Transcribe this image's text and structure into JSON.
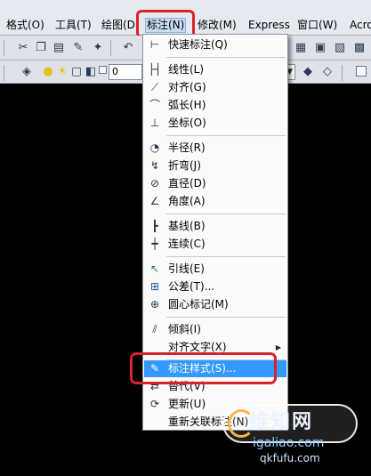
{
  "menubar": {
    "items": [
      "格式(O)",
      "工具(T)",
      "绘图(D)",
      "标注(N)",
      "修改(M)",
      "Express",
      "窗口(W)",
      "Acro"
    ]
  },
  "toolbar": {
    "layer_value": "0"
  },
  "dimension_menu": {
    "items": [
      {
        "label": "快速标注(Q)",
        "icon": "quick-dimension-icon"
      },
      {
        "label": "线性(L)",
        "icon": "linear-icon"
      },
      {
        "label": "对齐(G)",
        "icon": "aligned-icon"
      },
      {
        "label": "弧长(H)",
        "icon": "arc-length-icon"
      },
      {
        "label": "坐标(O)",
        "icon": "ordinate-icon"
      },
      {
        "label": "半径(R)",
        "icon": "radius-icon"
      },
      {
        "label": "折弯(J)",
        "icon": "jogged-icon"
      },
      {
        "label": "直径(D)",
        "icon": "diameter-icon"
      },
      {
        "label": "角度(A)",
        "icon": "angular-icon"
      },
      {
        "label": "基线(B)",
        "icon": "baseline-icon"
      },
      {
        "label": "连续(C)",
        "icon": "continue-icon"
      },
      {
        "label": "引线(E)",
        "icon": "leader-icon"
      },
      {
        "label": "公差(T)...",
        "icon": "tolerance-icon"
      },
      {
        "label": "圆心标记(M)",
        "icon": "center-mark-icon"
      },
      {
        "label": "倾斜(I)",
        "icon": "oblique-icon"
      },
      {
        "label": "对齐文字(X)",
        "icon": ""
      },
      {
        "label": "标注样式(S)...",
        "icon": "dimension-style-icon"
      },
      {
        "label": "替代(V)",
        "icon": "override-icon"
      },
      {
        "label": "更新(U)",
        "icon": "update-icon"
      },
      {
        "label": "重新关联标注(N)",
        "icon": ""
      }
    ]
  },
  "watermark": {
    "line1": "维知网",
    "line2": "igaliao.com",
    "line3": "qkfufu.com"
  },
  "colors": {
    "accent_selection": "#3399ff",
    "annotation_ring": "#d6242f"
  }
}
